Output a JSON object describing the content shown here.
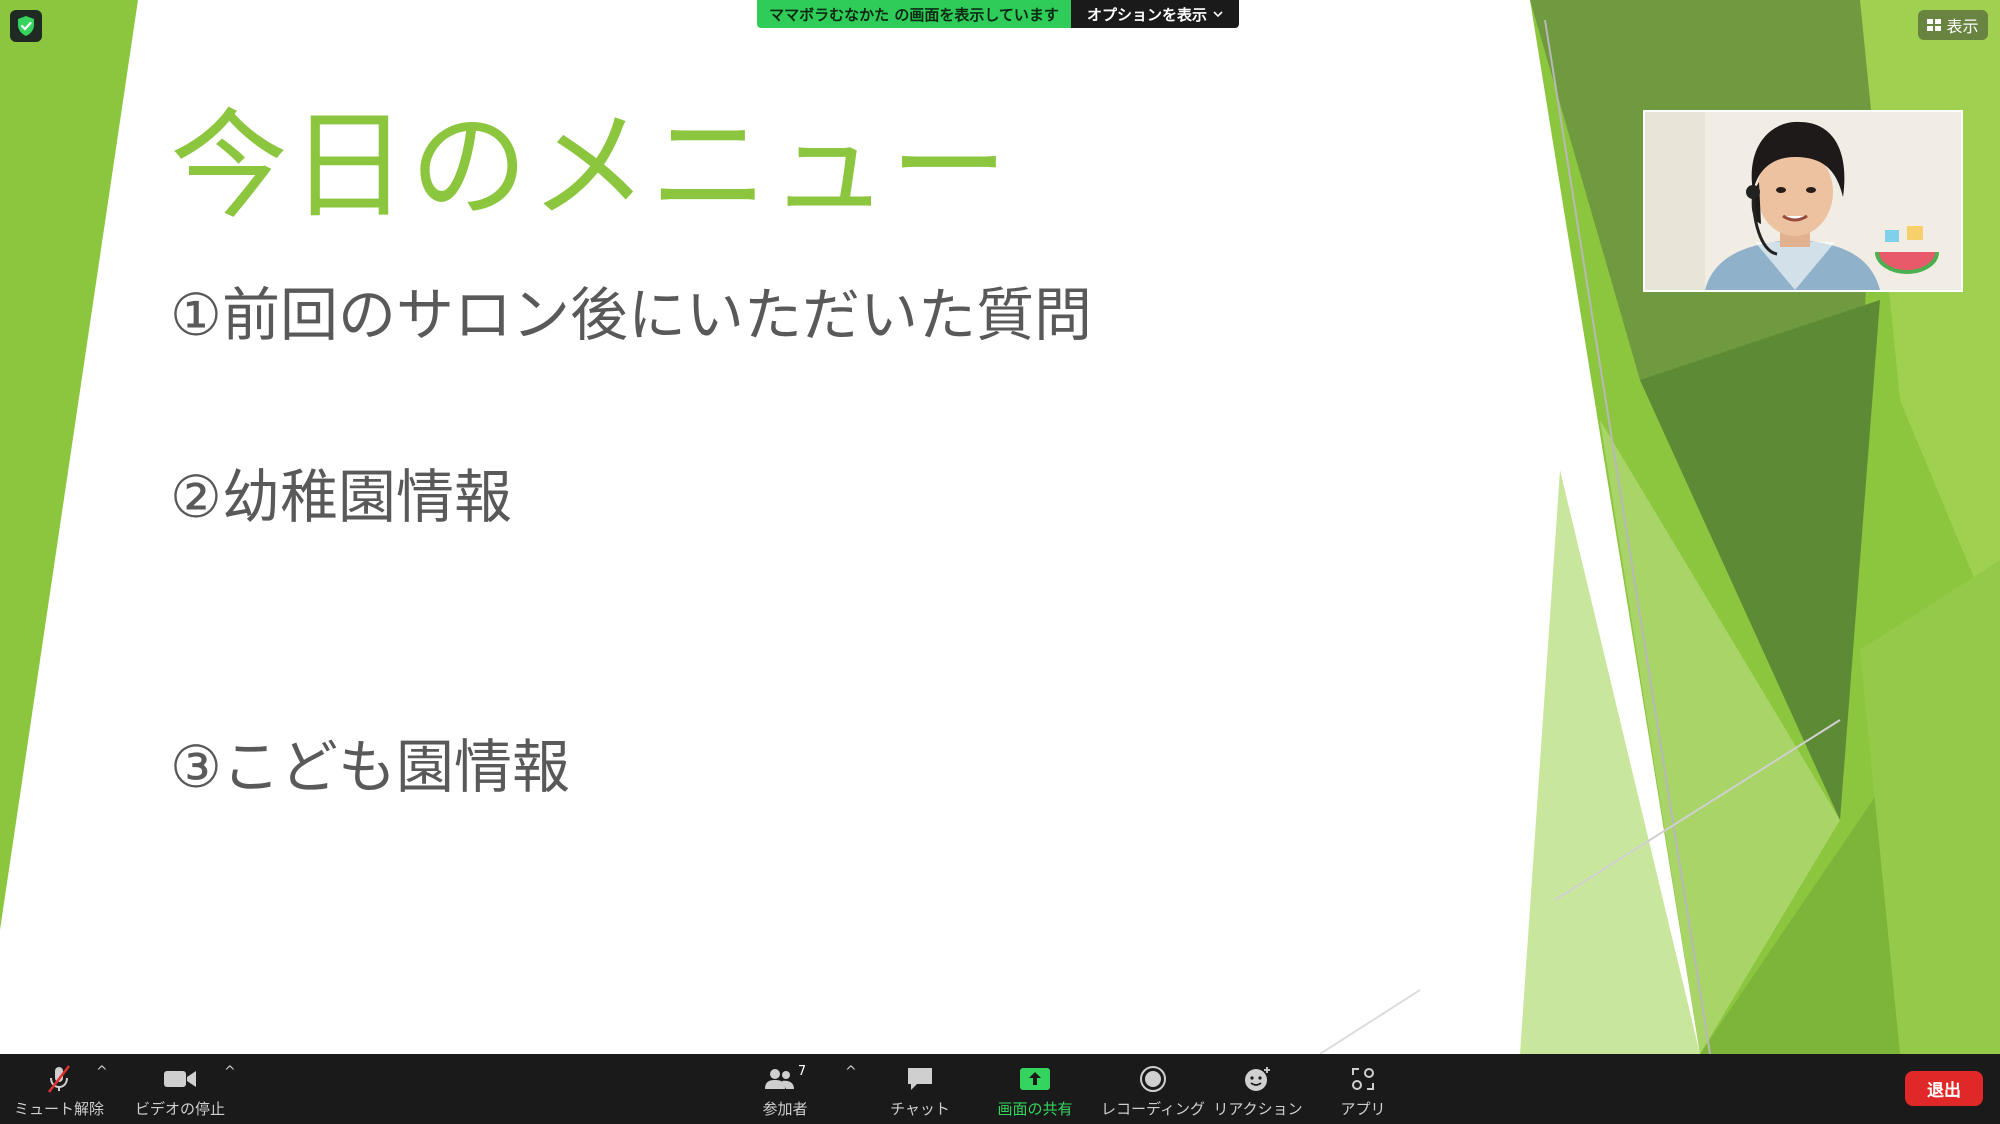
{
  "share_banner": {
    "status_text": "ママボラむなかた の画面を表示しています",
    "options_label": "オプションを表示"
  },
  "view_button": {
    "label": "表示"
  },
  "slide": {
    "title": "今日のメニュー",
    "items": [
      "①前回のサロン後にいただいた質問",
      "②幼稚園情報",
      "③こども園情報"
    ],
    "accent_color": "#8cc63f"
  },
  "toolbar": {
    "mute_label": "ミュート解除",
    "video_label": "ビデオの停止",
    "participants_label": "参加者",
    "participants_count": "7",
    "chat_label": "チャット",
    "share_label": "画面の共有",
    "record_label": "レコーディング",
    "reaction_label": "リアクション",
    "apps_label": "アプリ",
    "leave_label": "退出"
  },
  "icons": [
    "shield-icon",
    "microphone-muted-icon",
    "video-camera-icon",
    "participants-icon",
    "chat-icon",
    "share-screen-icon",
    "record-icon",
    "reaction-icon",
    "apps-icon",
    "grid-icon",
    "chevron-down-icon"
  ]
}
